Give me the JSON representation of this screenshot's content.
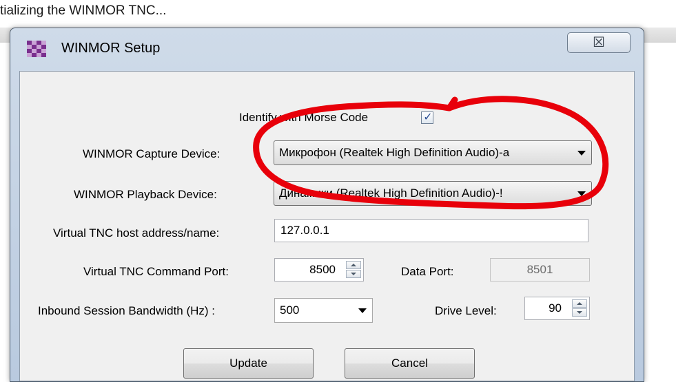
{
  "background": {
    "status_text": "tializing the WINMOR TNC..."
  },
  "window": {
    "title": "WINMOR Setup",
    "close_glyph": "☒"
  },
  "form": {
    "identify_label": "Identify with Morse Code",
    "identify_checked": true,
    "capture_label": "WINMOR Capture Device:",
    "capture_value": "Микрофон (Realtek High Definition Audio)-а",
    "playback_label": "WINMOR Playback Device:",
    "playback_value": "Динамики (Realtek High Definition Audio)-!",
    "host_label": "Virtual TNC host address/name:",
    "host_value": "127.0.0.1",
    "command_port_label": "Virtual TNC Command Port:",
    "command_port_value": "8500",
    "data_port_label": "Data Port:",
    "data_port_value": "8501",
    "bandwidth_label": "Inbound Session Bandwidth (Hz) :",
    "bandwidth_value": "500",
    "drive_label": "Drive Level:",
    "drive_value": "90"
  },
  "buttons": {
    "update": "Update",
    "cancel": "Cancel"
  },
  "colors": {
    "annotation": "#e8000a",
    "accent": "#2b4e93"
  },
  "icons": {
    "app": "checker-icon",
    "close": "close-icon",
    "dropdown": "chevron-down-icon"
  }
}
